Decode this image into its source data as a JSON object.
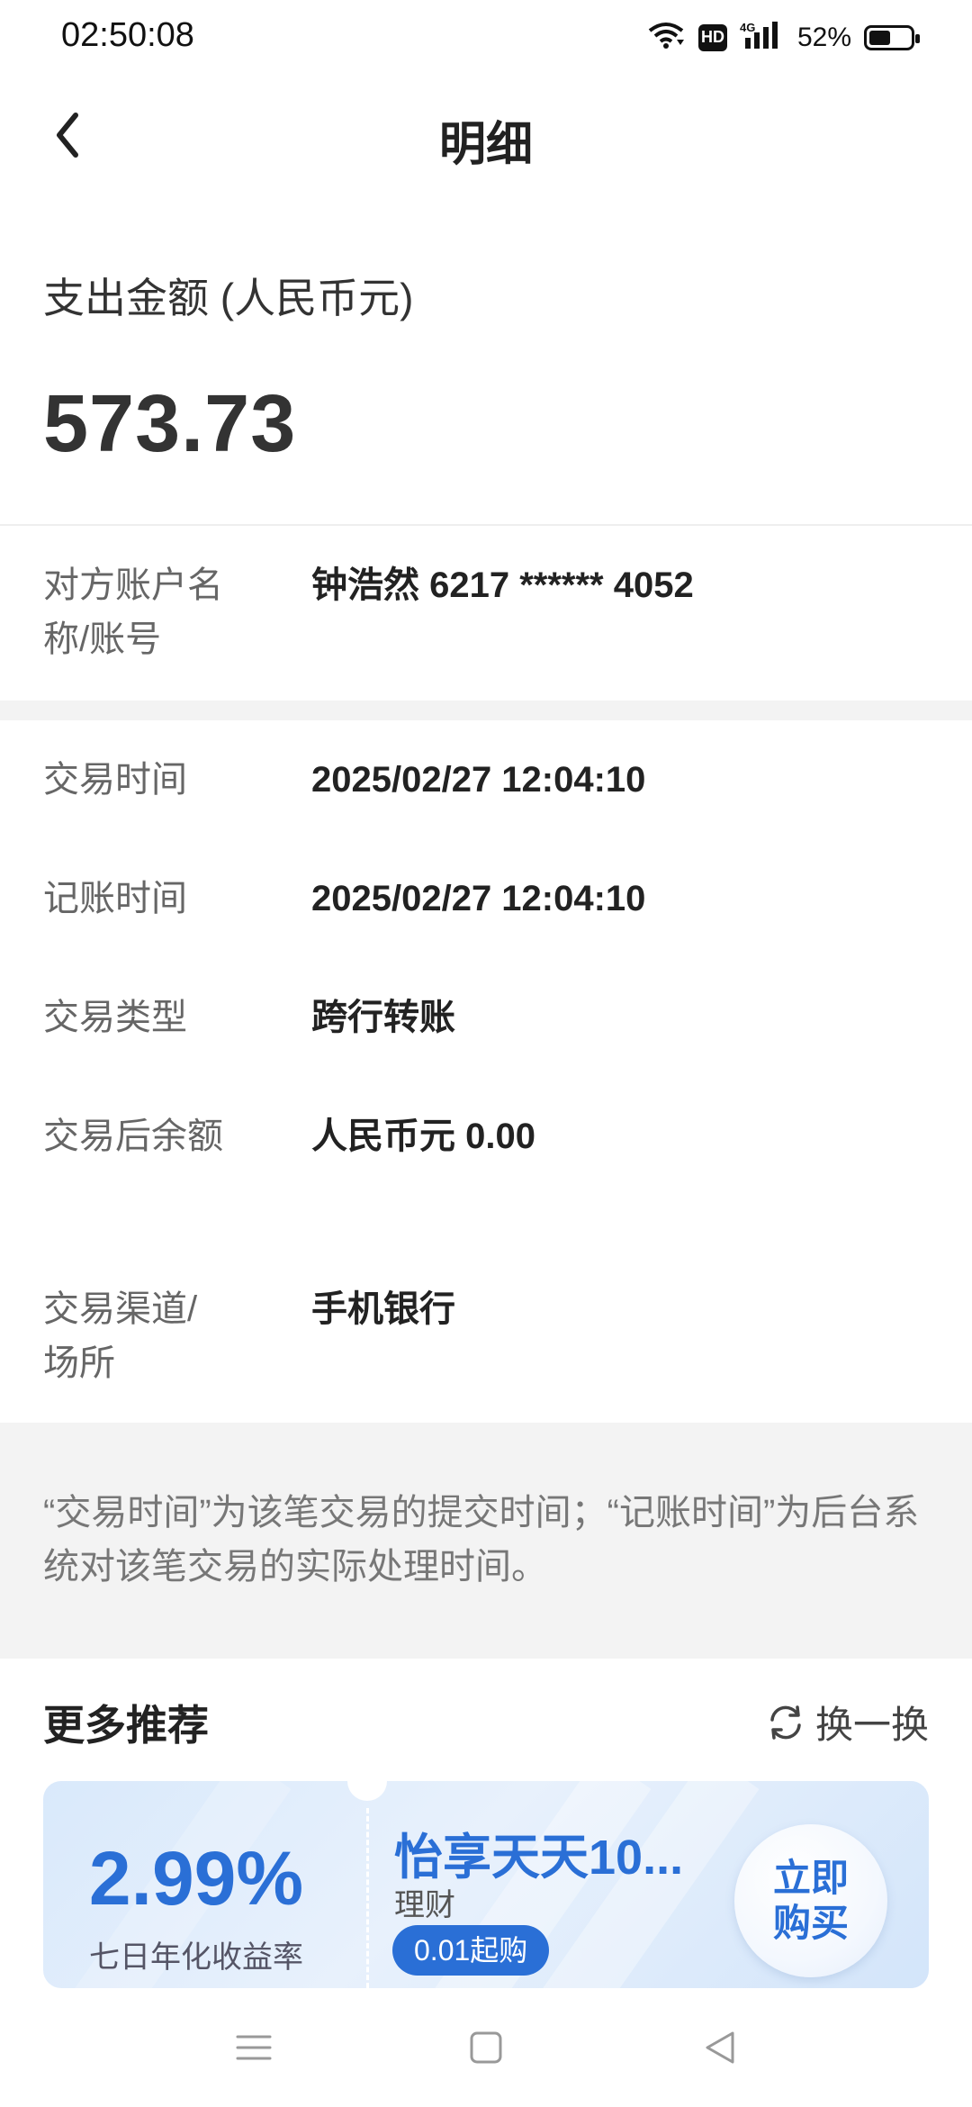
{
  "status_bar": {
    "time": "02:50:08",
    "network": "4G",
    "hd_label": "HD",
    "battery": "52%",
    "battery_level": 0.52
  },
  "header": {
    "title": "明细"
  },
  "amount": {
    "label": "支出金额 (人民币元)",
    "value": "573.73"
  },
  "counterparty": {
    "label": "对方账户名称/账号",
    "value": "钟浩然 6217 ****** 4052"
  },
  "details": [
    {
      "label": "交易时间",
      "value": "2025/02/27 12:04:10"
    },
    {
      "label": "记账时间",
      "value": "2025/02/27 12:04:10"
    },
    {
      "label": "交易类型",
      "value": "跨行转账"
    },
    {
      "label": "交易后余额",
      "value": "人民币元 0.00"
    },
    {
      "label": "交易渠道/场所",
      "value": "手机银行"
    }
  ],
  "note": "“交易时间”为该笔交易的提交时间；“记账时间”为后台系统对该笔交易的实际处理时间。",
  "recommend": {
    "title": "更多推荐",
    "refresh_label": "换一换",
    "product": {
      "rate": "2.99%",
      "rate_label": "七日年化收益率",
      "name": "怡享天天10...",
      "type": "理财",
      "tag": "0.01起购",
      "buy_label": "立即购买"
    }
  },
  "colors": {
    "accent": "#2a6fd6",
    "band": "#f3f3f3"
  }
}
